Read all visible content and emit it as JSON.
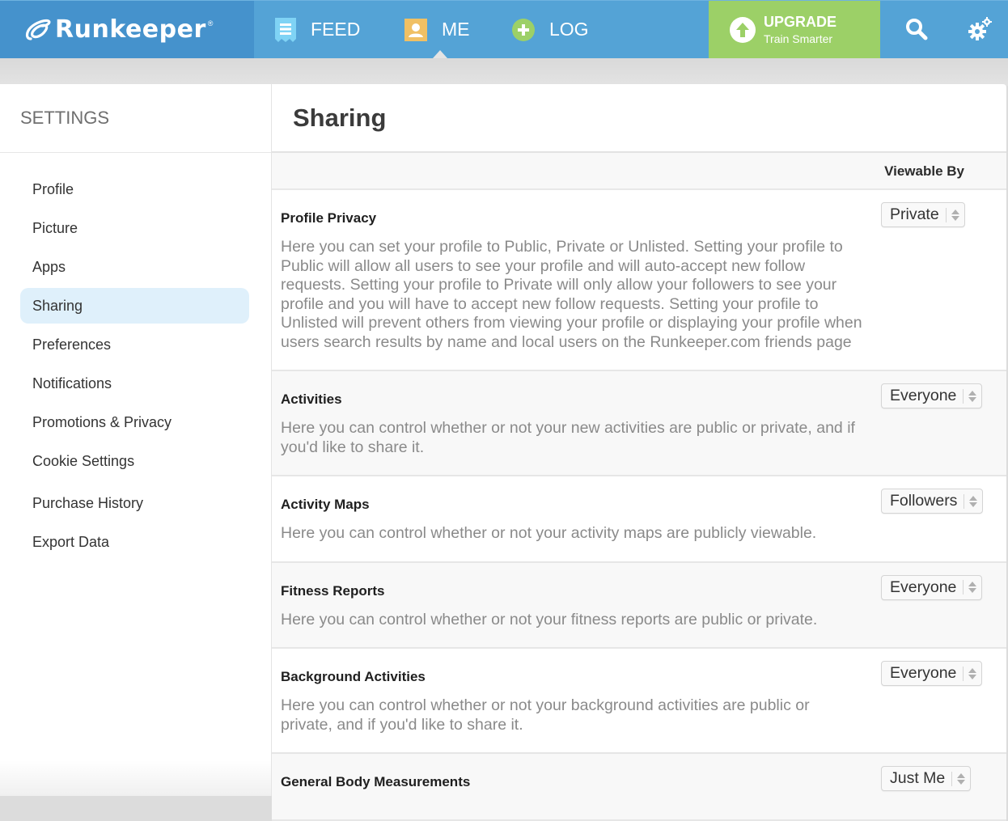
{
  "topbar": {
    "logo_text": "Runkeeper",
    "logo_reg": "®",
    "nav": [
      {
        "label": "FEED",
        "icon": "feed-icon",
        "icon_color": "#7fd3f5"
      },
      {
        "label": "ME",
        "icon": "user-icon",
        "icon_color": "#f0c064"
      },
      {
        "label": "LOG",
        "icon": "plus-circle-icon",
        "icon_color": "#9cd067"
      }
    ],
    "upgrade": {
      "title": "UPGRADE",
      "subtitle": "Train Smarter",
      "icon": "arrow-up-circle-icon",
      "color": "#9cd067"
    },
    "search_icon": "search-icon",
    "settings_icon": "gears-icon",
    "brand_color": "#4592cc"
  },
  "sidebar": {
    "title": "SETTINGS",
    "items": [
      {
        "label": "Profile",
        "active": false
      },
      {
        "label": "Picture",
        "active": false
      },
      {
        "label": "Apps",
        "active": false
      },
      {
        "label": "Sharing",
        "active": true
      },
      {
        "label": "Preferences",
        "active": false
      },
      {
        "label": "Notifications",
        "active": false
      },
      {
        "label": "Promotions & Privacy",
        "active": false
      },
      {
        "label": "Cookie Settings",
        "active": false
      },
      {
        "label": "Purchase History",
        "active": false
      },
      {
        "label": "Export Data",
        "active": false
      }
    ]
  },
  "main": {
    "title": "Sharing",
    "column_header": "Viewable By",
    "rows": [
      {
        "title": "Profile Privacy",
        "description": "Here you can set your profile to Public, Private or Unlisted. Setting your profile to Public will allow all users to see your profile and will auto-accept new follow requests. Setting your profile to Private will only allow your followers to see your profile and you will have to accept new follow requests. Setting your profile to Unlisted will prevent others from viewing your profile or displaying your profile when users search results by name and local users on the Runkeeper.com friends page",
        "value": "Private"
      },
      {
        "title": "Activities",
        "description": "Here you can control whether or not your new activities are public or private, and if you'd like to share it.",
        "value": "Everyone"
      },
      {
        "title": "Activity Maps",
        "description": "Here you can control whether or not your activity maps are publicly viewable.",
        "value": "Followers"
      },
      {
        "title": "Fitness Reports",
        "description": "Here you can control whether or not your fitness reports are public or private.",
        "value": "Everyone"
      },
      {
        "title": "Background Activities",
        "description": "Here you can control whether or not your background activities are public or private, and if you'd like to share it.",
        "value": "Everyone"
      },
      {
        "title": "General Body Measurements",
        "description": "",
        "value": "Just Me"
      }
    ]
  }
}
